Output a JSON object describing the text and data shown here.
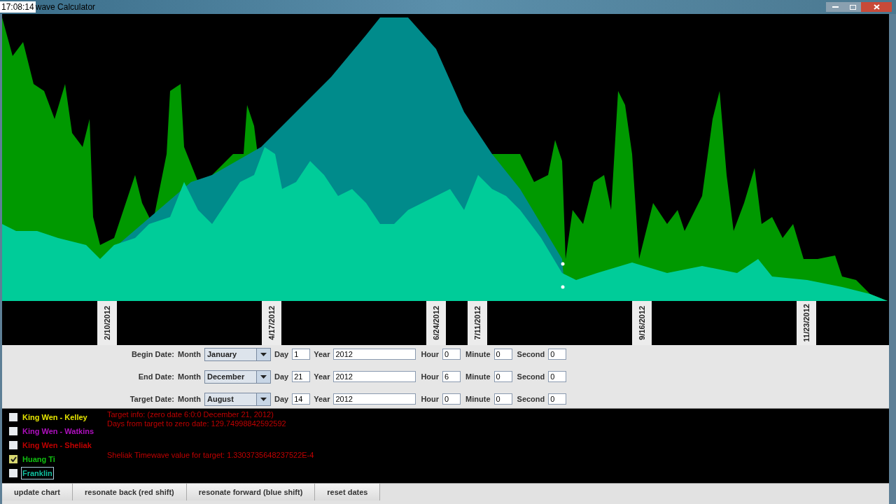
{
  "window": {
    "clock": "17:08:14",
    "title": "wave Calculator"
  },
  "date_labels": [
    "2/10/2012",
    "4/17/2012",
    "6/24/2012",
    "7/11/2012",
    "9/16/2012",
    "11/23/2012"
  ],
  "date_rows": [
    {
      "label": "Begin Date:",
      "month_label": "Month",
      "month": "January",
      "day_label": "Day",
      "day": "1",
      "year_label": "Year",
      "year": "2012",
      "hour_label": "Hour",
      "hour": "0",
      "minute_label": "Minute",
      "minute": "0",
      "second_label": "Second",
      "second": "0"
    },
    {
      "label": "End Date:",
      "month_label": "Month",
      "month": "December",
      "day_label": "Day",
      "day": "21",
      "year_label": "Year",
      "year": "2012",
      "hour_label": "Hour",
      "hour": "6",
      "minute_label": "Minute",
      "minute": "0",
      "second_label": "Second",
      "second": "0"
    },
    {
      "label": "Target Date:",
      "month_label": "Month",
      "month": "August",
      "day_label": "Day",
      "day": "14",
      "year_label": "Year",
      "year": "2012",
      "hour_label": "Hour",
      "hour": "0",
      "minute_label": "Minute",
      "minute": "0",
      "second_label": "Second",
      "second": "0"
    }
  ],
  "legend": [
    {
      "label": "King Wen - Kelley",
      "checked": false,
      "focused": false,
      "color": "#e6e600"
    },
    {
      "label": "King Wen - Watkins",
      "checked": false,
      "focused": false,
      "color": "#b010c0"
    },
    {
      "label": "King Wen - Sheliak",
      "checked": false,
      "focused": false,
      "color": "#c00000"
    },
    {
      "label": "Huang Ti",
      "checked": true,
      "focused": false,
      "color": "#10c010"
    },
    {
      "label": "Franklin",
      "checked": false,
      "focused": true,
      "color": "#10c0a0"
    }
  ],
  "target_info": [
    "Target info: (zero date 6:0:0 December 21, 2012)",
    "Days from target to zero date: 129.74998842592592"
  ],
  "value_info": "Sheliak Timewave value for target: 1.3303735648237522E-4",
  "buttons": [
    "update chart",
    "resonate back (red shift)",
    "resonate forward (blue shift)",
    "reset dates"
  ]
}
